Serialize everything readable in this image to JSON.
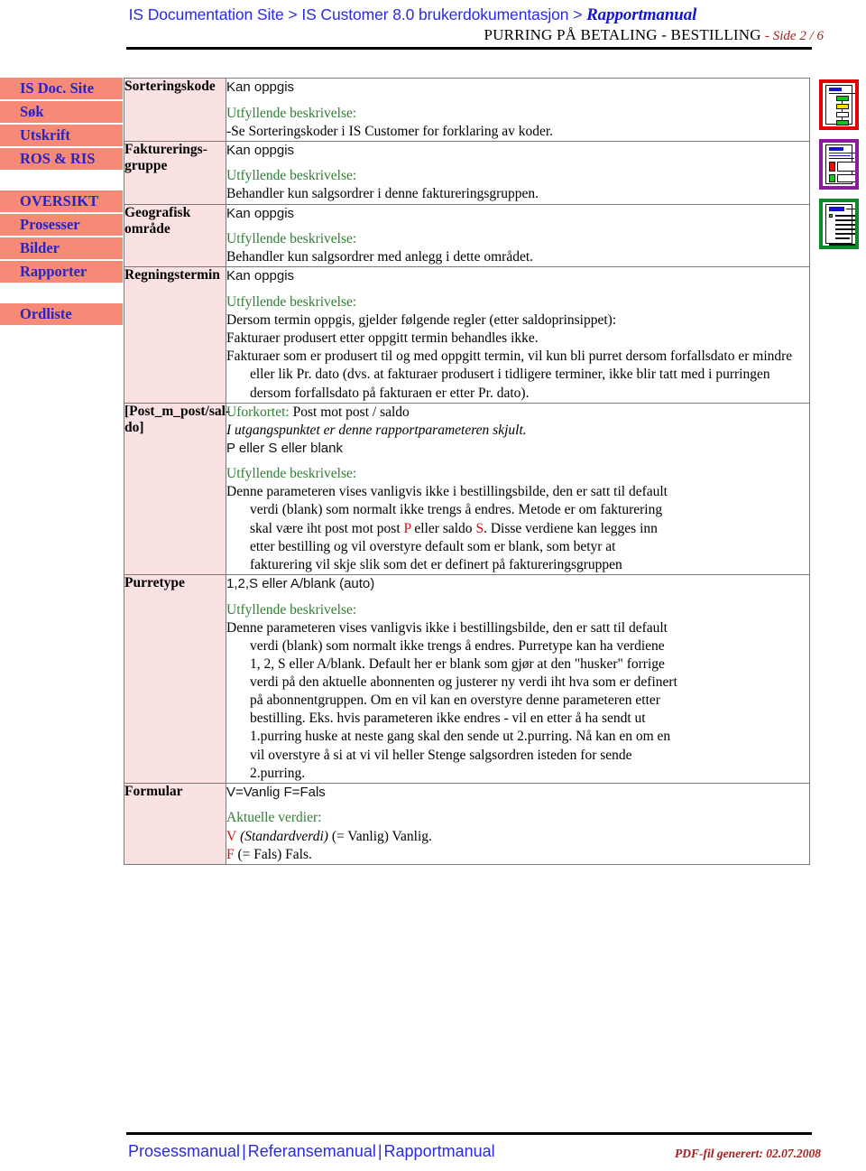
{
  "header": {
    "breadcrumb_part1": "IS Documentation Site",
    "separator": " > ",
    "breadcrumb_part2": "IS Customer 8.0 brukerdokumentasjon",
    "breadcrumb_current": "Rapportmanual",
    "doc_title": "PURRING PÅ BETALING - BESTILLING",
    "page_indicator": "- Side 2 / 6"
  },
  "sidebar": {
    "items": [
      {
        "label": "IS Doc. Site"
      },
      {
        "label": "Søk"
      },
      {
        "label": "Utskrift"
      },
      {
        "label": "ROS & RIS"
      },
      {
        "label": "OVERSIKT"
      },
      {
        "label": "Prosesser"
      },
      {
        "label": "Bilder"
      },
      {
        "label": "Rapporter"
      },
      {
        "label": "Ordliste"
      }
    ]
  },
  "icons": [
    {
      "name": "process-document-icon",
      "border_color": "#e00000"
    },
    {
      "name": "image-document-icon",
      "border_color": "#8c1a9c"
    },
    {
      "name": "report-document-icon",
      "border_color": "#0a8a28"
    }
  ],
  "table": {
    "green_label": "Utfyllende beskrivelse:",
    "rows": [
      {
        "label": "Sorteringskode",
        "value": "Kan oppgis",
        "desc_label": "Utfyllende beskrivelse:",
        "desc": "-Se Sorteringskoder i IS Customer for forklaring av koder."
      },
      {
        "label": "Faktureringsgruppe",
        "label_line1": "Faktureringsgruppe",
        "value": "Kan oppgis",
        "desc_label": "Utfyllende beskrivelse:",
        "desc": "Behandler kun salgsordrer i denne faktureringsgruppen."
      },
      {
        "label": "Geografisk område",
        "value": "Kan oppgis",
        "desc_label": "Utfyllende beskrivelse:",
        "desc": "Behandler kun salgsordrer med anlegg i dette området."
      },
      {
        "label": "Regningstermin",
        "value": "Kan oppgis",
        "desc_label": "Utfyllende beskrivelse:",
        "desc_line1": "Dersom termin oppgis, gjelder følgende regler (etter saldoprinsippet):",
        "desc_line2": "Fakturaer produsert etter oppgitt termin behandles ikke.",
        "desc_line3": "Fakturaer som er produsert til og med oppgitt termin, vil kun bli purret dersom forfallsdato er mindre eller lik Pr. dato (dvs. at fakturaer produsert i tidligere terminer, ikke blir tatt med i purringen dersom forfallsdato på fakturaen er etter Pr. dato)."
      },
      {
        "label": "[Post_m_post/saldo]",
        "uforkortet_label": "Uforkortet:",
        "uforkortet_value": " Post mot post / saldo",
        "italic_note": "I utgangspunktet er denne rapportparameteren skjult.",
        "value": "P eller S eller blank",
        "desc_label": "Utfyllende beskrivelse:",
        "desc_a": "Denne parameteren vises vanligvis ikke i bestillingsbilde, den er satt til default",
        "desc_b1": "verdi (blank) som normalt ikke trengs å endres. Metode er om fakturering",
        "desc_b2a": "skal være iht post mot post ",
        "desc_b2_p": "P",
        "desc_b2b": " eller saldo ",
        "desc_b2_s": "S",
        "desc_b2c": ". Disse verdiene kan legges inn",
        "desc_b3": "etter bestilling og vil overstyre default som er blank, som betyr at",
        "desc_b4": "fakturering vil skje slik som det er definert på faktureringsgruppen"
      },
      {
        "label": "Purretype",
        "value": "1,2,S eller A/blank (auto)",
        "desc_label": "Utfyllende beskrivelse:",
        "desc_a": "Denne parameteren vises vanligvis ikke i bestillingsbilde, den er satt til default",
        "desc_b1": "verdi (blank) som normalt ikke trengs å endres. Purretype kan ha verdiene",
        "desc_b2": "1, 2, S eller A/blank. Default her er blank som gjør at den \"husker\" forrige",
        "desc_b3": "verdi på den aktuelle abonnenten og justerer ny verdi iht hva som er definert",
        "desc_b4": "på abonnentgruppen. Om en vil kan en overstyre denne parameteren etter",
        "desc_b5": "bestilling. Eks. hvis parameteren ikke endres - vil en etter å ha sendt ut",
        "desc_b6": "1.purring huske at neste gang skal den sende ut 2.purring. Nå kan en om en",
        "desc_b7": "vil overstyre å si at vi vil heller Stenge salgsordren isteden for sende",
        "desc_b8": "2.purring."
      },
      {
        "label": "Formular",
        "value": "V=Vanlig F=Fals",
        "desc_label": "Aktuelle verdier:",
        "v_code": "V",
        "v_std": " (Standardverdi)",
        "v_text": " (= Vanlig) Vanlig.",
        "f_code": "F",
        "f_text": "   (= Fals) Fals."
      }
    ]
  },
  "footer": {
    "link1": "Prosessmanual",
    "sep": "|",
    "link2": "Referansemanual",
    "link3": "Rapportmanual",
    "generated": "PDF-fil generert: 02.07.2008"
  }
}
